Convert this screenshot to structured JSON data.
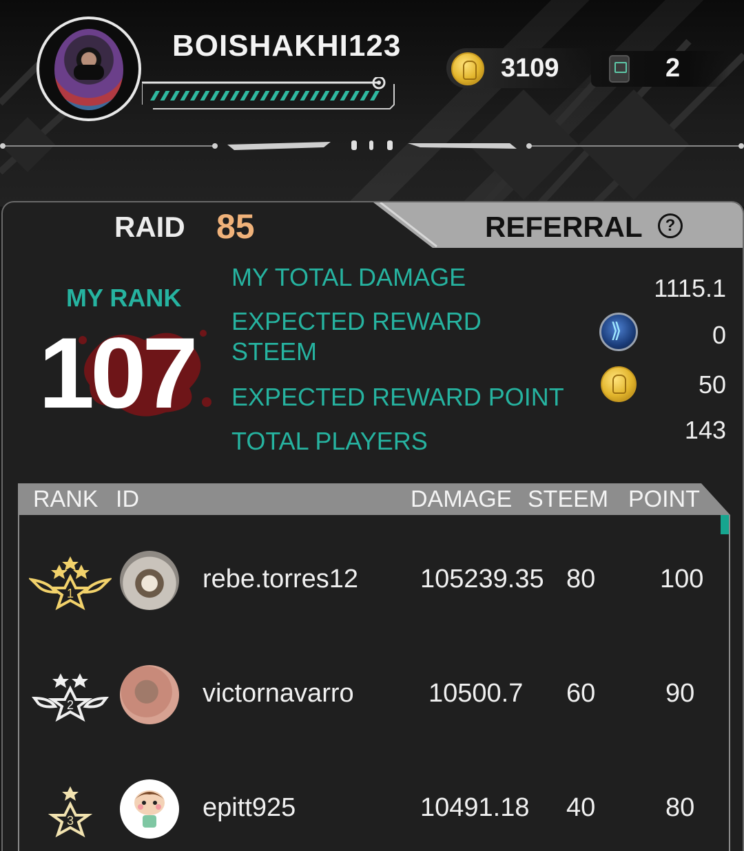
{
  "profile": {
    "username": "BOISHAKHI123",
    "coins": "3109",
    "tickets": "2"
  },
  "tabs": {
    "raid_label": "RAID",
    "raid_number": "85",
    "referral_label": "REFERRAL",
    "help_glyph": "?"
  },
  "my_rank": {
    "label": "MY RANK",
    "value": "107"
  },
  "stats": {
    "total_damage_label": "MY TOTAL DAMAGE",
    "total_damage_value": "1115.1",
    "reward_steem_label_1": "EXPECTED REWARD",
    "reward_steem_label_2": "STEEM",
    "reward_steem_value": "0",
    "reward_point_label": "EXPECTED REWARD POINT",
    "reward_point_value": "50",
    "total_players_label": "TOTAL PLAYERS",
    "total_players_value": "143"
  },
  "table": {
    "headers": {
      "rank": "RANK",
      "id": "ID",
      "damage": "DAMAGE",
      "steem": "STEEM",
      "point": "POINT"
    },
    "rows": [
      {
        "rank": 1,
        "id": "rebe.torres12",
        "damage": "105239.35",
        "steem": "80",
        "point": "100"
      },
      {
        "rank": 2,
        "id": "victornavarro",
        "damage": "10500.7",
        "steem": "60",
        "point": "90"
      },
      {
        "rank": 3,
        "id": "epitt925",
        "damage": "10491.18",
        "steem": "40",
        "point": "80"
      }
    ]
  },
  "icons": {
    "coin": "gold-coin-icon",
    "ticket": "ticket-icon",
    "steem": "steem-icon",
    "help": "help-icon"
  },
  "colors": {
    "accent_teal": "#26b3a0",
    "raid_number": "#f0b27a",
    "xp_bar": "#2fb8a0"
  }
}
